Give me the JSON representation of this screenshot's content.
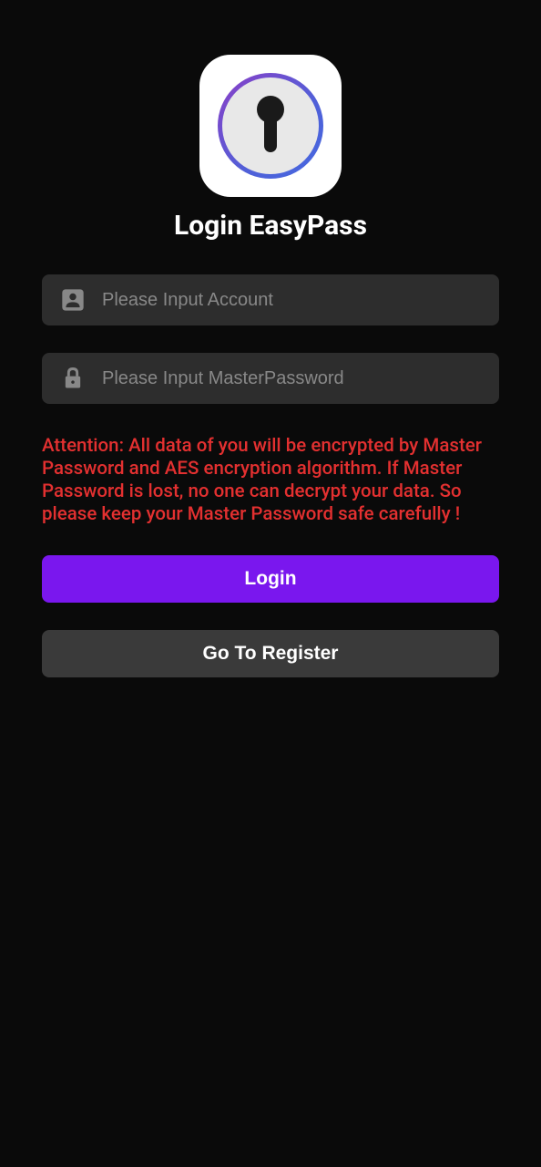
{
  "title": "Login EasyPass",
  "inputs": {
    "account": {
      "placeholder": "Please Input Account",
      "value": ""
    },
    "password": {
      "placeholder": "Please Input MasterPassword",
      "value": ""
    }
  },
  "warning": "Attention: All data of you will be encrypted by Master Password and AES encryption algorithm. If Master Password is lost, no one can decrypt your data. So please keep your Master Password safe carefully !",
  "buttons": {
    "login": "Login",
    "register": "Go To Register"
  }
}
